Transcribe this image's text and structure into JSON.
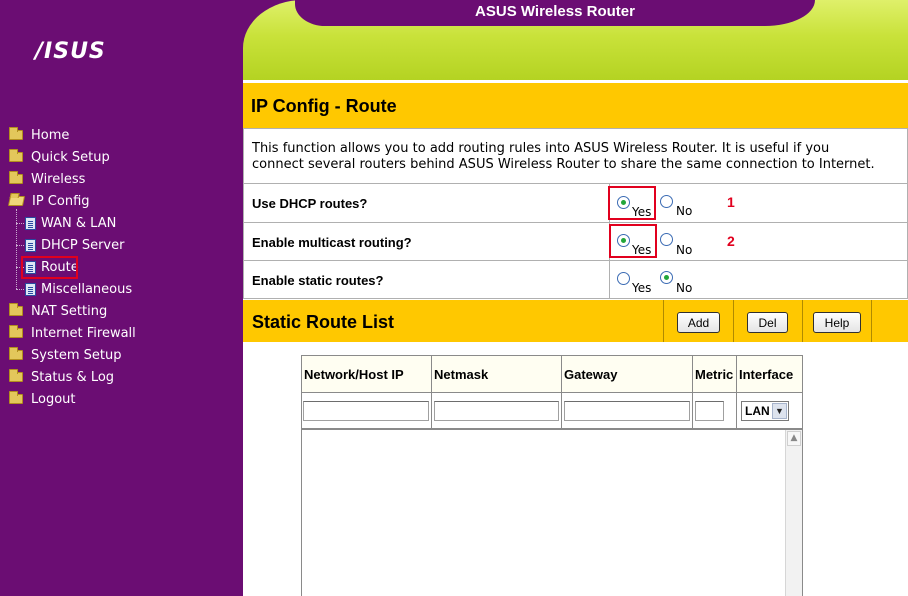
{
  "header": {
    "title": "ASUS Wireless Router",
    "logo": "/ISUS"
  },
  "sidebar": {
    "items": [
      {
        "label": "Home",
        "icon": "folder-icon"
      },
      {
        "label": "Quick Setup",
        "icon": "folder-icon"
      },
      {
        "label": "Wireless",
        "icon": "folder-icon"
      },
      {
        "label": "IP Config",
        "icon": "folder-open-icon"
      },
      {
        "label": "WAN & LAN",
        "icon": "document-icon"
      },
      {
        "label": "DHCP Server",
        "icon": "document-icon"
      },
      {
        "label": "Route",
        "icon": "document-icon",
        "selected": true
      },
      {
        "label": "Miscellaneous",
        "icon": "document-icon"
      },
      {
        "label": "NAT Setting",
        "icon": "folder-icon"
      },
      {
        "label": "Internet Firewall",
        "icon": "folder-icon"
      },
      {
        "label": "System Setup",
        "icon": "folder-icon"
      },
      {
        "label": "Status & Log",
        "icon": "folder-icon"
      },
      {
        "label": "Logout",
        "icon": "folder-icon"
      }
    ]
  },
  "page": {
    "title": "IP Config - Route",
    "description_line1": "This function allows you to add routing rules into ASUS Wireless Router. It is useful if you",
    "description_line2": "connect several routers behind ASUS Wireless Router to share the same connection to Internet."
  },
  "options": [
    {
      "label": "Use DHCP routes?",
      "yes": "Yes",
      "no": "No",
      "selected": "Yes",
      "annotation": "1"
    },
    {
      "label": "Enable multicast routing?",
      "yes": "Yes",
      "no": "No",
      "selected": "Yes",
      "annotation": "2"
    },
    {
      "label": "Enable static routes?",
      "yes": "Yes",
      "no": "No",
      "selected": "No"
    }
  ],
  "static_routes": {
    "title": "Static Route List",
    "add_label": "Add",
    "del_label": "Del",
    "help_label": "Help",
    "columns": [
      "Network/Host IP",
      "Netmask",
      "Gateway",
      "Metric",
      "Interface"
    ],
    "inputs": {
      "network": "",
      "netmask": "",
      "gateway": "",
      "metric": ""
    },
    "interface_value": "LAN",
    "rows": []
  },
  "colors": {
    "sidebar": "#6b0d73",
    "accent": "#ffc800",
    "header_green": "#c9e23a",
    "annotation": "#e1001e"
  }
}
